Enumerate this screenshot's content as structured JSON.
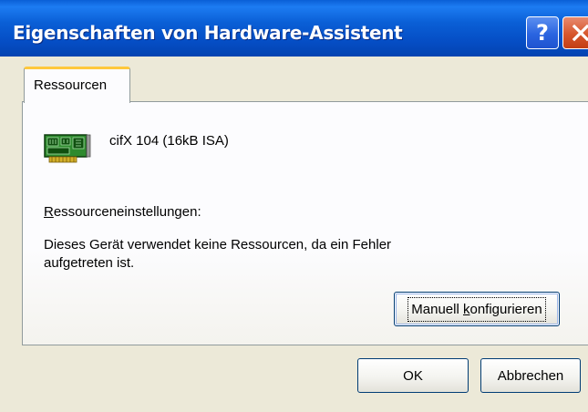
{
  "window": {
    "title": "Eigenschaften von Hardware-Assistent",
    "help_label": "?",
    "close_icon": "close-icon"
  },
  "tabs": [
    {
      "label": "Ressourcen",
      "selected": true
    }
  ],
  "device": {
    "icon": "circuit-board-icon",
    "name": "cifX 104 (16kB ISA)"
  },
  "resources": {
    "label_first": "R",
    "label_rest": "essourceneinstellungen:",
    "status_text": "Dieses Gerät verwendet keine Ressourcen, da ein Fehler aufgetreten ist."
  },
  "buttons": {
    "manual_before": "Manuell ",
    "manual_accel": "k",
    "manual_after": "onfigurieren",
    "ok": "OK",
    "cancel": "Abbrechen"
  },
  "colors": {
    "titlebar": "#0a5fd6",
    "close_button": "#d6562c",
    "dialog_background": "#ece9d8",
    "tab_highlight": "#ffc83c"
  }
}
